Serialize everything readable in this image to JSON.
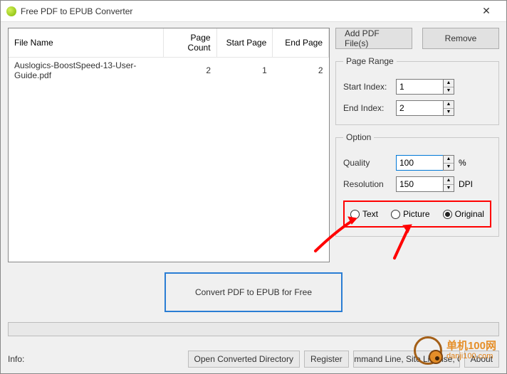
{
  "window": {
    "title": "Free PDF to EPUB Converter"
  },
  "table": {
    "headers": {
      "file_name": "File Name",
      "page_count": "Page Count",
      "start_page": "Start Page",
      "end_page": "End Page"
    },
    "rows": [
      {
        "file_name": "Auslogics-BoostSpeed-13-User-Guide.pdf",
        "page_count": "2",
        "start_page": "1",
        "end_page": "2"
      }
    ]
  },
  "buttons": {
    "add": "Add PDF File(s)",
    "remove": "Remove",
    "convert": "Convert PDF to EPUB for Free",
    "open_dir": "Open Converted Directory",
    "register": "Register",
    "cmdline": "Command Line, Site License, OK",
    "about": "About"
  },
  "page_range": {
    "legend": "Page Range",
    "start_label": "Start Index:",
    "start_value": "1",
    "end_label": "End Index:",
    "end_value": "2"
  },
  "option": {
    "legend": "Option",
    "quality_label": "Quality",
    "quality_value": "100",
    "quality_unit": "%",
    "resolution_label": "Resolution",
    "resolution_value": "150",
    "resolution_unit": "DPI",
    "radios": {
      "text": "Text",
      "picture": "Picture",
      "original": "Original",
      "selected": "original"
    }
  },
  "footer": {
    "info_label": "Info:"
  },
  "watermark": {
    "cn": "单机100网",
    "en": "danji100.com"
  }
}
